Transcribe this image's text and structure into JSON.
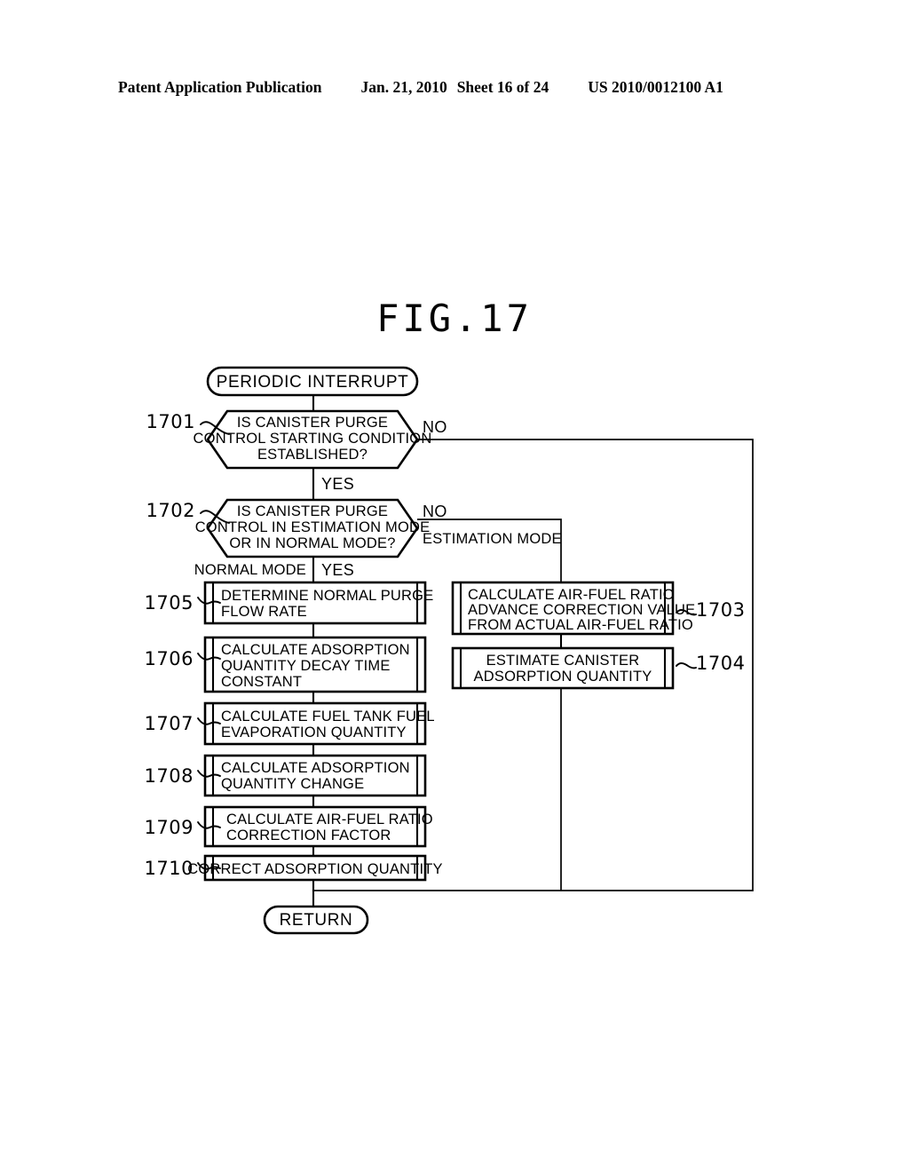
{
  "header": {
    "publication": "Patent Application Publication",
    "date": "Jan. 21, 2010",
    "sheet": "Sheet 16 of 24",
    "doc_id": "US 2010/0012100 A1"
  },
  "figure": {
    "title": "FIG.17"
  },
  "flowchart": {
    "start": {
      "label": "PERIODIC INTERRUPT"
    },
    "end": {
      "label": "RETURN"
    },
    "nodes": [
      {
        "ref": "1701",
        "type": "decision",
        "lines": [
          "IS CANISTER PURGE",
          "CONTROL STARTING CONDITION",
          "ESTABLISHED?"
        ],
        "yes_label": "YES",
        "no_label": "NO"
      },
      {
        "ref": "1702",
        "type": "decision",
        "lines": [
          "IS CANISTER PURGE",
          "CONTROL IN ESTIMATION MODE",
          "OR IN NORMAL MODE?"
        ],
        "yes_label": "YES",
        "no_label": "NO",
        "yes_branch_label": "NORMAL MODE",
        "no_branch_label": "ESTIMATION MODE"
      },
      {
        "ref": "1703",
        "type": "process",
        "lines": [
          "CALCULATE AIR-FUEL RATIO",
          "ADVANCE CORRECTION VALUE",
          "FROM ACTUAL AIR-FUEL RATIO"
        ]
      },
      {
        "ref": "1704",
        "type": "process",
        "lines": [
          "ESTIMATE CANISTER",
          "ADSORPTION QUANTITY"
        ]
      },
      {
        "ref": "1705",
        "type": "process",
        "lines": [
          "DETERMINE NORMAL PURGE",
          "FLOW RATE"
        ]
      },
      {
        "ref": "1706",
        "type": "process",
        "lines": [
          "CALCULATE ADSORPTION",
          "QUANTITY DECAY TIME",
          "CONSTANT"
        ]
      },
      {
        "ref": "1707",
        "type": "process",
        "lines": [
          "CALCULATE FUEL TANK FUEL",
          "EVAPORATION QUANTITY"
        ]
      },
      {
        "ref": "1708",
        "type": "process",
        "lines": [
          "CALCULATE ADSORPTION",
          "QUANTITY CHANGE"
        ]
      },
      {
        "ref": "1709",
        "type": "process",
        "lines": [
          "CALCULATE AIR-FUEL RATIO",
          "CORRECTION FACTOR"
        ]
      },
      {
        "ref": "1710",
        "type": "process",
        "lines": [
          "CORRECT ADSORPTION QUANTITY"
        ]
      }
    ]
  },
  "colors": {
    "ink": "#000000",
    "paper": "#ffffff"
  }
}
